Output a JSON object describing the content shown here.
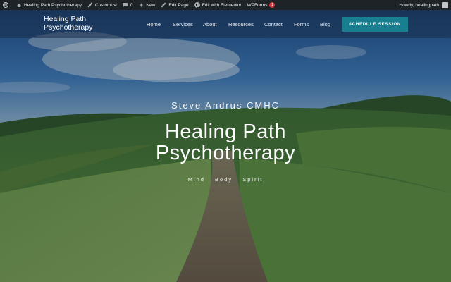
{
  "admin_bar": {
    "site_name": "Healing Path Psychotherapy",
    "customize": "Customize",
    "comments_count": "0",
    "new": "New",
    "edit_page": "Edit Page",
    "edit_elementor": "Edit with Elementor",
    "wpforms": "WPForms",
    "wpforms_badge": "1",
    "greeting": "Howdy, healingpath"
  },
  "header": {
    "logo_line1": "Healing Path",
    "logo_line2": "Psychotherapy",
    "nav": [
      "Home",
      "Services",
      "About",
      "Resources",
      "Contact",
      "Forms",
      "Blog"
    ],
    "cta": "SCHEDULE SESSION"
  },
  "hero": {
    "subtitle": "Steve Andrus CMHC",
    "title_line1": "Healing Path",
    "title_line2": "Psychotherapy",
    "tagline": [
      "Mind",
      "Body",
      "Spirit"
    ]
  }
}
